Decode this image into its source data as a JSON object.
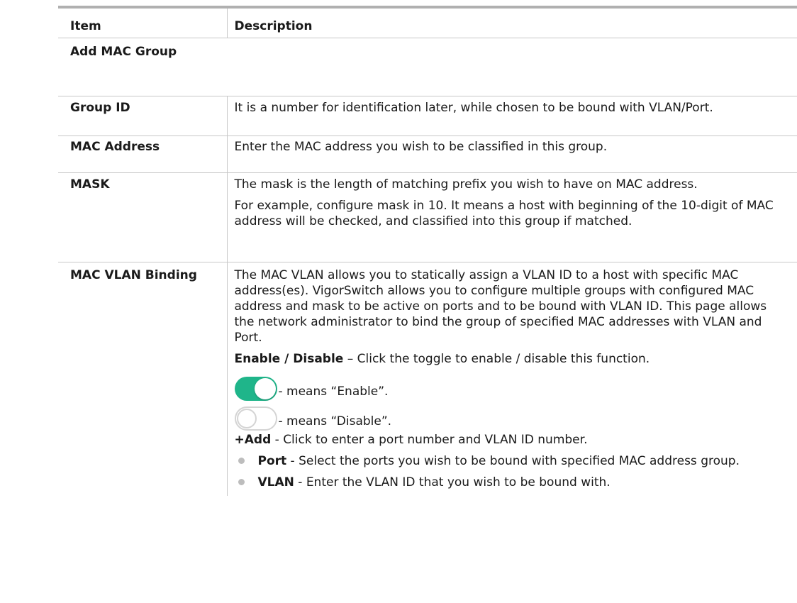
{
  "table": {
    "header": {
      "item": "Item",
      "description": "Description"
    },
    "section_title": "Add MAC Group",
    "rows": {
      "group_id": {
        "item": "Group ID",
        "description": "It is a number for identification later, while chosen to be bound with VLAN/Port."
      },
      "mac_address": {
        "item": "MAC Address",
        "description": "Enter the MAC address you wish to be classified in this group."
      },
      "mask": {
        "item": "MASK",
        "description_1": "The mask is the length of matching prefix you wish to have on MAC address.",
        "description_2": "For example, configure mask in 10. It means a host with beginning of the 10-digit of MAC address will be checked, and classified into this group if matched."
      },
      "mac_vlan_binding": {
        "item": "MAC VLAN Binding",
        "description_1": "The MAC VLAN allows you to statically assign a VLAN ID to a host with specific MAC address(es). VigorSwitch allows you to configure multiple groups with configured MAC address and mask to be active on ports and to be bound with VLAN ID. This page allows the network administrator to bind the group of specified MAC addresses with VLAN and Port.",
        "enable_disable_label": "Enable / Disable",
        "enable_disable_text": " – Click the toggle to enable / disable this function.",
        "toggle_on_text": "- means “Enable”.",
        "toggle_off_text": "- means “Disable”.",
        "add_label": "+Add",
        "add_text": " - Click to enter a port number and VLAN ID number.",
        "bullets": [
          {
            "label": "Port",
            "text": " - Select the ports you wish to be bound with specified MAC address group."
          },
          {
            "label": "VLAN",
            "text": " - Enter the VLAN ID that you wish to be bound with."
          }
        ]
      }
    }
  },
  "colors": {
    "toggle_on": "#1fb58a",
    "toggle_off_border": "#d4d4d4",
    "table_top_rule": "#b0b0b0",
    "grid_line": "#c8c8c8"
  },
  "icons": {
    "toggle_on": "toggle-on-icon",
    "toggle_off": "toggle-off-icon",
    "bullet": "bullet-dot-icon"
  }
}
